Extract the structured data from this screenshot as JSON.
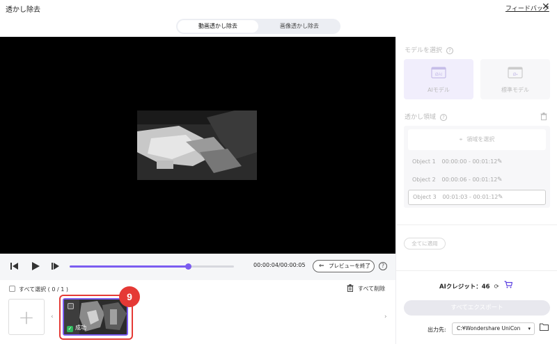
{
  "window": {
    "title": "透かし除去",
    "feedback_label": "フィードバック",
    "close_glyph": "✕"
  },
  "mode_tabs": [
    {
      "label": "動画透かし除去",
      "active": true
    },
    {
      "label": "画像透かし除去",
      "active": false
    }
  ],
  "player": {
    "timecode": "00:00:04/00:00:05",
    "progress": 0.72,
    "end_preview_label": "プレビューを終了",
    "help_glyph": "?"
  },
  "file_list": {
    "select_all_label": "すべて選択 ( 0 / 1 )",
    "delete_all_label": "すべて削除",
    "add_glyph": "+",
    "items": [
      {
        "status": "成功",
        "status_icon": "check-icon"
      }
    ],
    "highlight_badge": "9"
  },
  "panel": {
    "model_title": "モデルを選択",
    "models": [
      {
        "label": "AIモデル",
        "selected": true
      },
      {
        "label": "標準モデル",
        "selected": false
      }
    ],
    "area_title": "透かし領域",
    "select_area_label": "領域を選択",
    "objects": [
      {
        "name": "Object 1",
        "range": "00:00:00 - 00:01:12",
        "selected": false
      },
      {
        "name": "Object 2",
        "range": "00:00:06 - 00:01:12",
        "selected": false
      },
      {
        "name": "Object 3",
        "range": "00:01:03 - 00:01:12",
        "selected": true
      }
    ],
    "apply_all_label": "全てに適用",
    "credits_label": "AIクレジット：46",
    "export_all_label": "すべてエクスポート",
    "output_label": "出力先:",
    "output_path": "C:¥Wondershare UniCon"
  },
  "colors": {
    "accent": "#7b5cf0",
    "highlight": "#e53935",
    "success": "#2eb85c"
  }
}
